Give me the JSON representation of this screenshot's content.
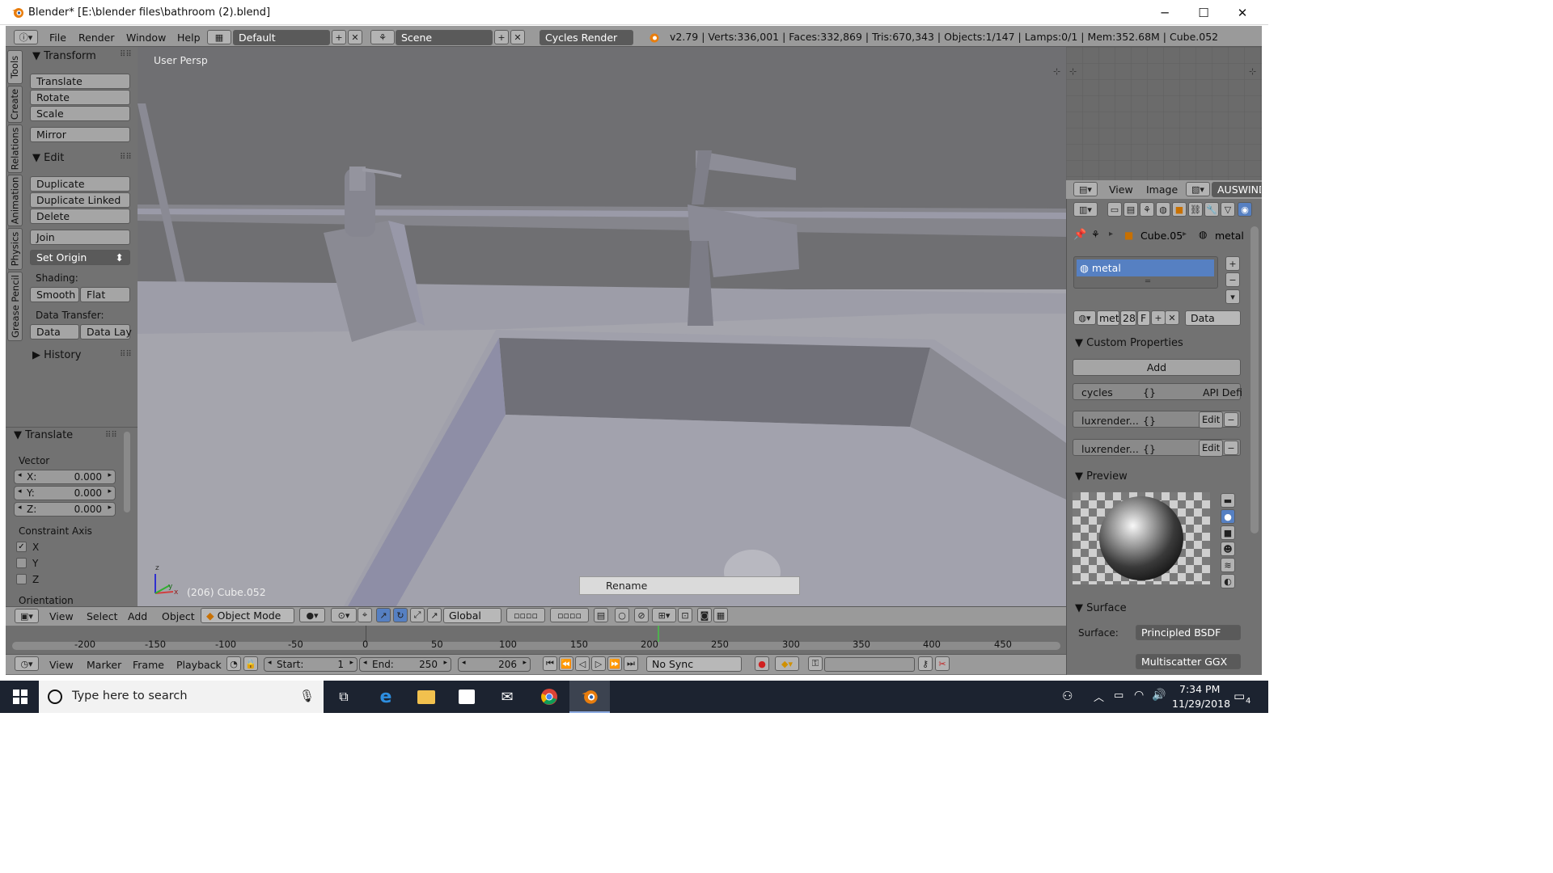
{
  "window": {
    "title": "Blender* [E:\\blender files\\bathroom (2).blend]",
    "minimize": "─",
    "maximize": "☐",
    "close": "✕"
  },
  "info": {
    "menus": [
      "File",
      "Render",
      "Window",
      "Help"
    ],
    "layout": "Default",
    "scene": "Scene",
    "engine": "Cycles Render",
    "stats": "v2.79 | Verts:336,001 | Faces:332,869 | Tris:670,343 | Objects:1/147 | Lamps:0/1 | Mem:352.68M | Cube.052"
  },
  "tabs": [
    "Tools",
    "Create",
    "Relations",
    "Animation",
    "Physics",
    "Grease Pencil"
  ],
  "tools": {
    "transform_header": "Transform",
    "translate": "Translate",
    "rotate": "Rotate",
    "scale": "Scale",
    "mirror": "Mirror",
    "edit_header": "Edit",
    "duplicate": "Duplicate",
    "duplicate_linked": "Duplicate Linked",
    "delete": "Delete",
    "join": "Join",
    "set_origin": "Set Origin",
    "shading_label": "Shading:",
    "smooth": "Smooth",
    "flat": "Flat",
    "data_transfer_label": "Data Transfer:",
    "data": "Data",
    "data_lay": "Data Lay",
    "history_header": "History"
  },
  "operator": {
    "header": "Translate",
    "vector_label": "Vector",
    "x": "X:",
    "x_val": "0.000",
    "y": "Y:",
    "y_val": "0.000",
    "z": "Z:",
    "z_val": "0.000",
    "constraint_label": "Constraint Axis",
    "cx": "X",
    "cy": "Y",
    "cz": "Z",
    "cx_checked": "✓",
    "orientation_label": "Orientation"
  },
  "viewport": {
    "view_label": "User Persp",
    "object_label": "(206) Cube.052",
    "tooltip": "Rename",
    "axis_x": "x",
    "axis_y": "y",
    "axis_z": "z"
  },
  "vp_header": {
    "view": "View",
    "select": "Select",
    "add": "Add",
    "object": "Object",
    "mode": "Object Mode",
    "orientation": "Global"
  },
  "timeline": {
    "ticks": [
      "-200",
      "-150",
      "-100",
      "-50",
      "0",
      "50",
      "100",
      "150",
      "200",
      "250",
      "300",
      "350",
      "400",
      "450"
    ],
    "view": "View",
    "marker": "Marker",
    "frame": "Frame",
    "playback": "Playback",
    "start_label": "Start:",
    "start": "1",
    "end_label": "End:",
    "end": "250",
    "current": "206",
    "sync": "No Sync"
  },
  "image_editor": {
    "view": "View",
    "image": "Image",
    "name": "AUSWIND-"
  },
  "properties": {
    "object": "Cube.05",
    "material": "metal",
    "slot": "metal",
    "mat_short": "met",
    "users": "28",
    "fake": "F",
    "link": "Data",
    "custom_props": "Custom Properties",
    "add": "Add",
    "prop1_name": "cycles",
    "prop1_val": "{}",
    "prop1_api": "API Defi",
    "prop2_name": "luxrender...",
    "prop2_val": "{}",
    "prop3_name": "luxrender...",
    "prop3_val": "{}",
    "edit": "Edit",
    "preview": "Preview",
    "surface": "Surface",
    "surface_label": "Surface:",
    "surface_val": "Principled BSDF",
    "distribution": "Multiscatter GGX"
  },
  "taskbar": {
    "search_placeholder": "Type here to search",
    "time": "7:34 PM",
    "date": "11/29/2018",
    "notif_count": "4"
  }
}
